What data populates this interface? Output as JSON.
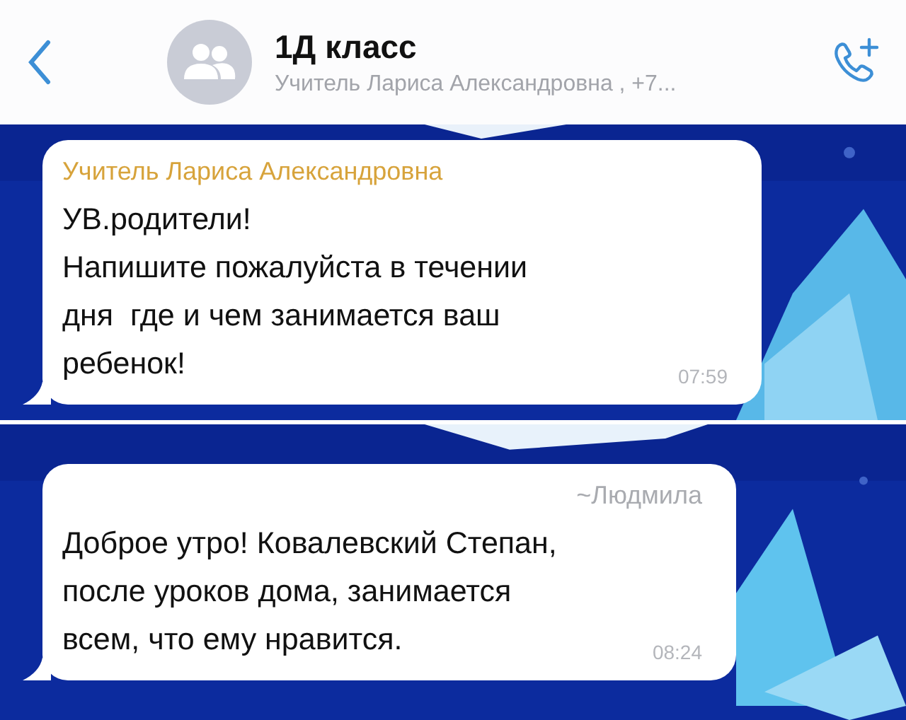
{
  "header": {
    "title": "1Д класс",
    "subtitle": "Учитель Лариса Александровна , +7..."
  },
  "panels": [
    {
      "messages": [
        {
          "kind": "named",
          "sender": "Учитель Лариса Александровна",
          "text": "УВ.родители!\nНапишите пожалуйста в течении\nдня  где и чем занимается ваш\nребенок!",
          "time": "07:59"
        }
      ]
    },
    {
      "messages": [
        {
          "kind": "contact",
          "sender": "~Людмила",
          "text": "Доброе утро! Ковалевский Степан,\nпосле уроков дома, занимается\nвсем, что ему нравится.",
          "time": "08:24"
        }
      ]
    }
  ]
}
